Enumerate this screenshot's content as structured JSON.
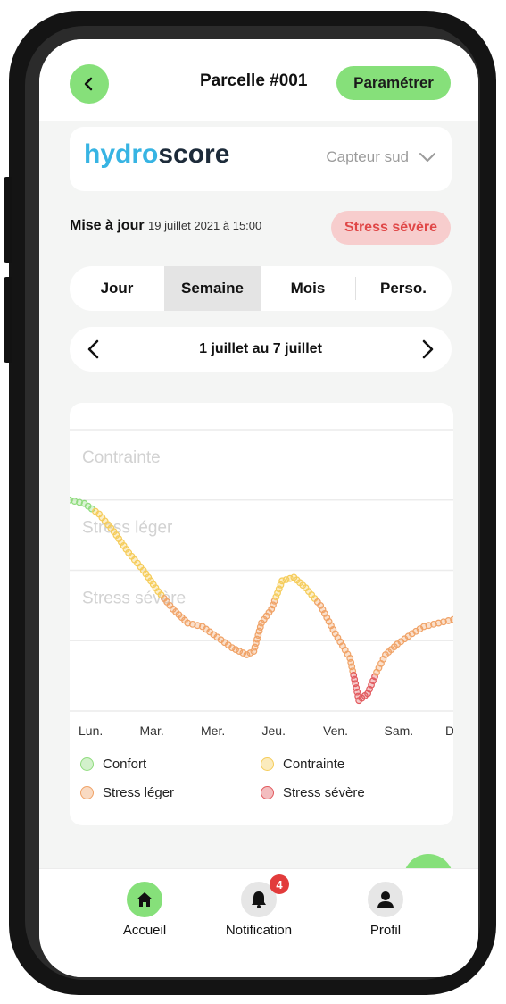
{
  "header": {
    "title": "Parcelle #001",
    "settings_label": "Paramétrer"
  },
  "logo": {
    "part1": "hydro",
    "part2": "score"
  },
  "sensor": {
    "selected": "Capteur sud"
  },
  "update": {
    "prefix": "Mise à jour",
    "date": "19 juillet 2021 à 15:00",
    "status": "Stress sévère"
  },
  "tabs": [
    {
      "label": "Jour"
    },
    {
      "label": "Semaine"
    },
    {
      "label": "Mois"
    },
    {
      "label": "Perso."
    }
  ],
  "date_range": {
    "label": "1 juillet au 7 juillet"
  },
  "colors": {
    "accent": "#86e07a",
    "confort": "#8fdc7d",
    "contrainte": "#f5cc5a",
    "stress_leger": "#f0a266",
    "stress_severe": "#e25a5e"
  },
  "chart_data": {
    "type": "line",
    "title": "",
    "categories": [
      "Lun.",
      "Mar.",
      "Mer.",
      "Jeu.",
      "Ven.",
      "Sam.",
      "Dim."
    ],
    "zones": [
      "Confort",
      "Contrainte",
      "Stress léger",
      "Stress sévère"
    ],
    "ylim": [
      0,
      4
    ],
    "legend_position": "bottom",
    "series": [
      {
        "x": [
          0,
          0.25,
          0.5,
          0.75,
          1.0,
          1.25,
          1.5,
          1.75,
          2.0,
          2.25,
          2.5,
          2.75,
          3.0,
          3.12,
          3.25,
          3.42,
          3.6,
          3.8,
          4.0,
          4.25,
          4.5,
          4.75,
          4.9,
          5.05,
          5.2,
          5.35,
          5.55,
          5.8,
          6.0,
          6.25,
          6.5
        ],
        "values": [
          3.0,
          2.95,
          2.8,
          2.55,
          2.25,
          2.0,
          1.7,
          1.45,
          1.25,
          1.2,
          1.05,
          0.9,
          0.8,
          0.85,
          1.25,
          1.45,
          1.85,
          1.9,
          1.75,
          1.5,
          1.1,
          0.75,
          0.15,
          0.25,
          0.55,
          0.8,
          0.95,
          1.1,
          1.2,
          1.25,
          1.3
        ]
      }
    ]
  },
  "legend": [
    {
      "label": "Confort",
      "color": "#8fdc7d"
    },
    {
      "label": "Contrainte",
      "color": "#f5cc5a"
    },
    {
      "label": "Stress léger",
      "color": "#f0a266"
    },
    {
      "label": "Stress sévère",
      "color": "#e25a5e"
    }
  ],
  "nav": [
    {
      "label": "Accueil",
      "icon": "home-icon"
    },
    {
      "label": "Notification",
      "icon": "bell-icon",
      "badge": "4"
    },
    {
      "label": "Profil",
      "icon": "user-icon"
    }
  ]
}
